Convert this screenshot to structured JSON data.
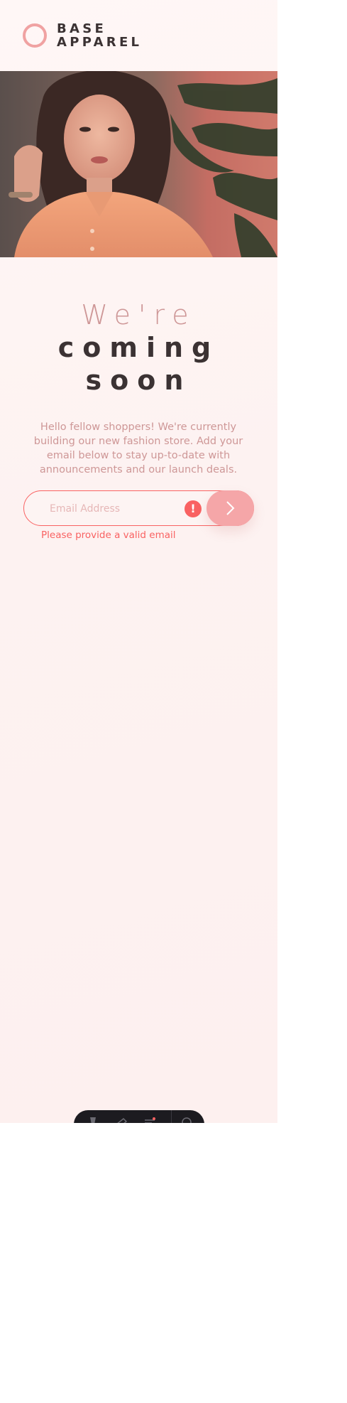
{
  "brand": {
    "name_line1": "BASE",
    "name_line2": "APPAREL",
    "accent_color": "#f0a2a2"
  },
  "hero": {
    "image": "woman-in-peach-shirt-photo"
  },
  "headline": {
    "light": "We're",
    "bold_line1": "coming",
    "bold_line2": "soon"
  },
  "description": "Hello fellow shoppers! We're currently building our new fashion store. Add your email below to stay up-to-date with announcements and our launch deals.",
  "form": {
    "email_placeholder": "Email Address",
    "email_value": "",
    "error_icon_glyph": "!",
    "error_message": "Please provide a valid email",
    "submit_icon": "chevron-right-icon"
  },
  "bottom_toolbar": {
    "icons": [
      "inspect-icon",
      "ruler-icon",
      "layers-icon",
      "settings-icon"
    ]
  },
  "colors": {
    "primary_text": "#3b3233",
    "soft_red": "#ce9797",
    "error_red": "#f96262",
    "button_pink": "#f5a6a8"
  }
}
